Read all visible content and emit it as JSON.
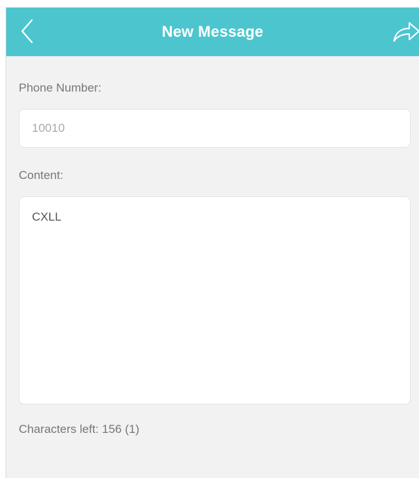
{
  "header": {
    "title": "New Message",
    "back_icon": "chevron-left-icon",
    "send_icon": "share-arrow-icon",
    "background_color": "#4cc5cf"
  },
  "form": {
    "phone_label": "Phone Number:",
    "phone_value": "10010",
    "content_label": "Content:",
    "content_value": "CXLL",
    "chars_left_label": "Characters left:",
    "chars_left_count": "156 (1)"
  }
}
